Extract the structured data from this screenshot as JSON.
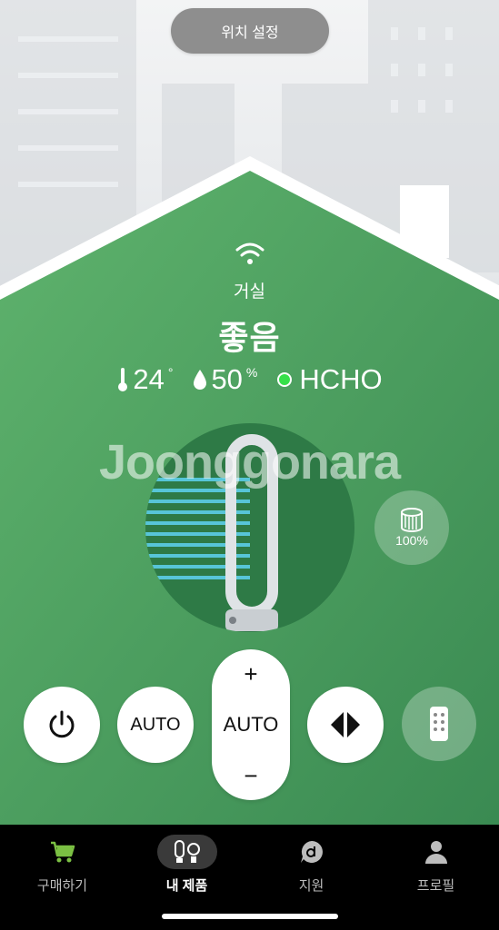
{
  "header": {
    "location_button": "위치 설정"
  },
  "room": {
    "name": "거실",
    "air_quality": "좋음",
    "temperature": "24",
    "temperature_unit": "°",
    "humidity": "50",
    "humidity_unit": "%",
    "hcho_label": "HCHO"
  },
  "watermark": "Joonggonara",
  "filter": {
    "life": "100%"
  },
  "controls": {
    "auto_label": "AUTO",
    "speed_label": "AUTO",
    "speed_up": "+",
    "speed_down": "−"
  },
  "tabs": [
    {
      "label": "구매하기",
      "icon": "cart-icon"
    },
    {
      "label": "내 제품",
      "icon": "my-products-icon"
    },
    {
      "label": "지원",
      "icon": "support-icon"
    },
    {
      "label": "프로필",
      "icon": "profile-icon"
    }
  ],
  "colors": {
    "house_green": "#4aa05e",
    "status_good": "#36e04a",
    "cart_green": "#7bc043",
    "tabbar": "#000000"
  }
}
